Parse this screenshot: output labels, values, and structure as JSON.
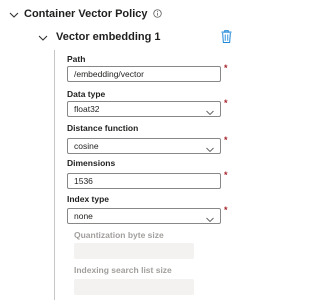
{
  "policy": {
    "title": "Container Vector Policy",
    "info_icon": "info-icon",
    "collapse_icon": "chevron-down-icon"
  },
  "embedding": {
    "title": "Vector embedding 1",
    "collapse_icon": "chevron-down-icon",
    "delete_icon": "trash-icon"
  },
  "fields": {
    "path": {
      "label": "Path",
      "value": "/embedding/vector",
      "required_mark": "*"
    },
    "data_type": {
      "label": "Data type",
      "value": "float32",
      "required_mark": "*"
    },
    "distance_function": {
      "label": "Distance function",
      "value": "cosine",
      "required_mark": "*"
    },
    "dimensions": {
      "label": "Dimensions",
      "value": "1536",
      "required_mark": "*"
    },
    "index_type": {
      "label": "Index type",
      "value": "none",
      "required_mark": "*"
    },
    "quantization_byte_size": {
      "label": "Quantization byte size",
      "value": ""
    },
    "indexing_search_list_size": {
      "label": "Indexing search list size",
      "value": ""
    }
  },
  "colors": {
    "accent": "#0078d4",
    "required": "#a4262c",
    "disabled_text": "#a19f9d",
    "disabled_fill": "#f3f2f1"
  }
}
